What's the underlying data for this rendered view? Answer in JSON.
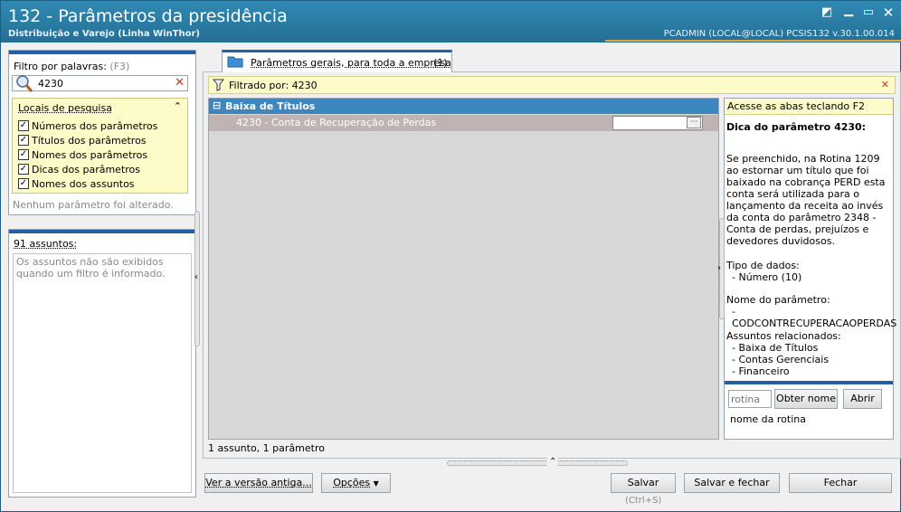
{
  "window": {
    "title": "132 - Parâmetros da presidência",
    "subtitle": "Distribuição e Varejo (Linha WinThor)",
    "user_info": "PCADMIN (LOCAL@LOCAL)   PCSIS132  v.30.1.00.014",
    "accent_color": "#e8a23a"
  },
  "filter_panel": {
    "label": "Filtro por palavras:",
    "shortcut": "(F3)",
    "search_value": "4230",
    "search_icon": "magnifier-icon",
    "clear_icon": "close-icon",
    "locations_title": "Locais de pesquisa",
    "locations": [
      {
        "label": "Números dos parâmetros",
        "checked": true
      },
      {
        "label": "Títulos dos parâmetros",
        "checked": true
      },
      {
        "label": "Nomes dos parâmetros",
        "checked": true
      },
      {
        "label": "Dicas dos parâmetros",
        "checked": true
      },
      {
        "label": "Nomes dos assuntos",
        "checked": true
      }
    ],
    "status": "Nenhum parâmetro foi alterado."
  },
  "subjects_panel": {
    "count_label": "91 assuntos:",
    "message": "Os assuntos não são exibidos quando um filtro é informado."
  },
  "tab": {
    "label": "Parâmetros gerais, para toda a empresa",
    "count": "(1)"
  },
  "filter_bar": {
    "label": "Filtrado por: 4230"
  },
  "grid": {
    "group": {
      "expander": "⊟",
      "label": "Baixa de Títulos"
    },
    "rows": [
      {
        "label": "4230 - Conta de Recuperação de Perdas",
        "value": "",
        "button": "···"
      }
    ],
    "footer": "1 assunto, 1 parâmetro"
  },
  "help_panel": {
    "hint": "Acesse as abas teclando F2",
    "title": "Dica do parâmetro 4230:",
    "description": "Se preenchido, na Rotina 1209 ao estornar um título que foi baixado na cobrança PERD esta conta será utilizada para o lançamento da receita ao invés da conta do parâmetro 2348 - Conta de perdas, prejuízos e devedores duvidosos.",
    "data_type_label": "Tipo de dados:",
    "data_type": "- Número (10)",
    "param_name_label": "Nome do parâmetro:",
    "param_name": "- CODCONTRECUPERACAOPERDAS",
    "related_label": "Assuntos relacionados:",
    "related": [
      "- Baixa de Títulos",
      "- Contas Gerenciais",
      "- Financeiro"
    ],
    "rotina_placeholder": "rotina",
    "get_name_button": "Obter nome",
    "open_button": "Abrir",
    "rotina_name_label": "nome da rotina"
  },
  "footer_buttons": {
    "old_version": "Ver a versão antiga...",
    "options": "Opções",
    "save": "Salvar",
    "save_shortcut": "(Ctrl+S)",
    "save_close": "Salvar e fechar",
    "close": "Fechar"
  }
}
